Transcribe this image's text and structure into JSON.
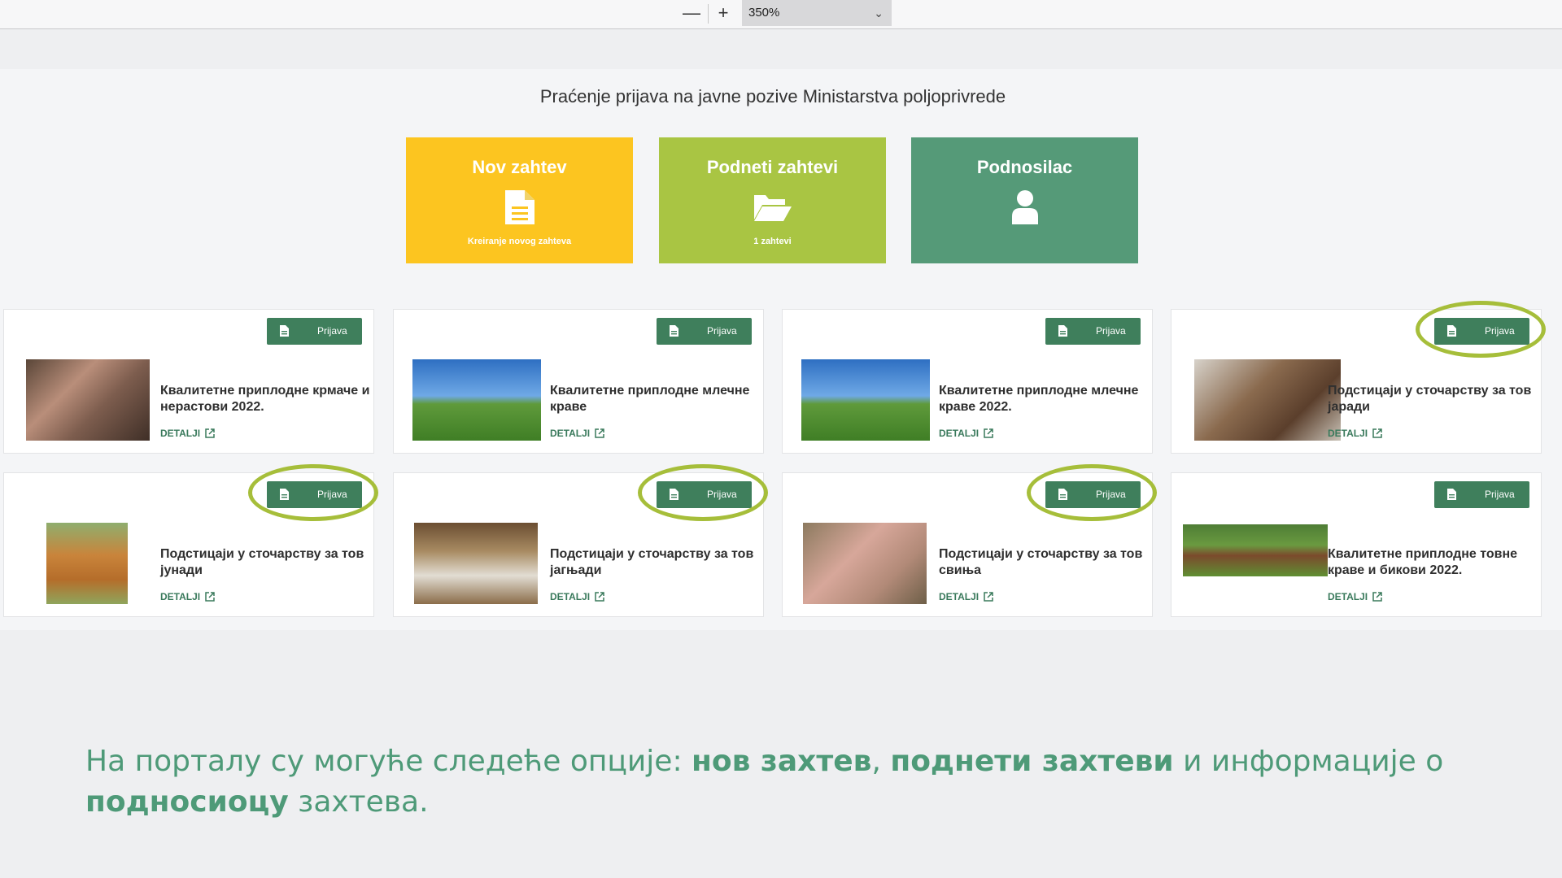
{
  "toolbar": {
    "zoom_out": "—",
    "zoom_in": "+",
    "zoom_value": "350%"
  },
  "page": {
    "title": "Praćenje prijava na javne pozive Ministarstva poljoprivrede"
  },
  "tiles": [
    {
      "title": "Nov zahtev",
      "subtitle": "Kreiranje novog zahteva",
      "icon": "document-icon",
      "color": "#fcc520"
    },
    {
      "title": "Podneti zahtevi",
      "subtitle": "1 zahtevi",
      "icon": "folder-open-icon",
      "color": "#a9c543"
    },
    {
      "title": "Podnosilac",
      "subtitle": "",
      "icon": "user-icon",
      "color": "#559a78"
    }
  ],
  "cards": [
    {
      "title": "Квалитетне приплодне крмаче и нерастови 2022.",
      "link": "DETALJI",
      "button": "Prijava",
      "image": "pigs-in-pen",
      "highlighted": false
    },
    {
      "title": "Квалитетне приплодне млечне краве",
      "link": "DETALJI",
      "button": "Prijava",
      "image": "holstein-cow",
      "highlighted": false
    },
    {
      "title": "Квалитетне приплодне млечне краве 2022.",
      "link": "DETALJI",
      "button": "Prijava",
      "image": "holstein-cow",
      "highlighted": false
    },
    {
      "title": "Подстицаји у сточарству за тов јаради",
      "link": "DETALJI",
      "button": "Prijava",
      "image": "goats-feeding",
      "highlighted": true
    },
    {
      "title": "Подстицаји у сточарству за тов јунади",
      "link": "DETALJI",
      "button": "Prijava",
      "image": "brown-cow",
      "highlighted": true
    },
    {
      "title": "Подстицаји у сточарству за тов јагњади",
      "link": "DETALJI",
      "button": "Prijava",
      "image": "lambs-in-barn",
      "highlighted": true
    },
    {
      "title": "Подстицаји у сточарству за тов свиња",
      "link": "DETALJI",
      "button": "Prijava",
      "image": "piglets",
      "highlighted": true
    },
    {
      "title": "Квалитетне приплодне товне краве и бикови 2022.",
      "link": "DETALJI",
      "button": "Prijava",
      "image": "cattle-in-field",
      "highlighted": false
    }
  ],
  "caption": {
    "part1": "На порталу су могуће следеће опције: ",
    "bold1": "нов захтев",
    "part2": ", ",
    "bold2": "поднети захтеви",
    "part3": " и информације о ",
    "bold3": "подносиоцу",
    "part4": " захтева."
  },
  "colors": {
    "accent_green": "#3f7f5c",
    "highlight_ring": "#a6be3a",
    "caption_text": "#4e9a78"
  }
}
